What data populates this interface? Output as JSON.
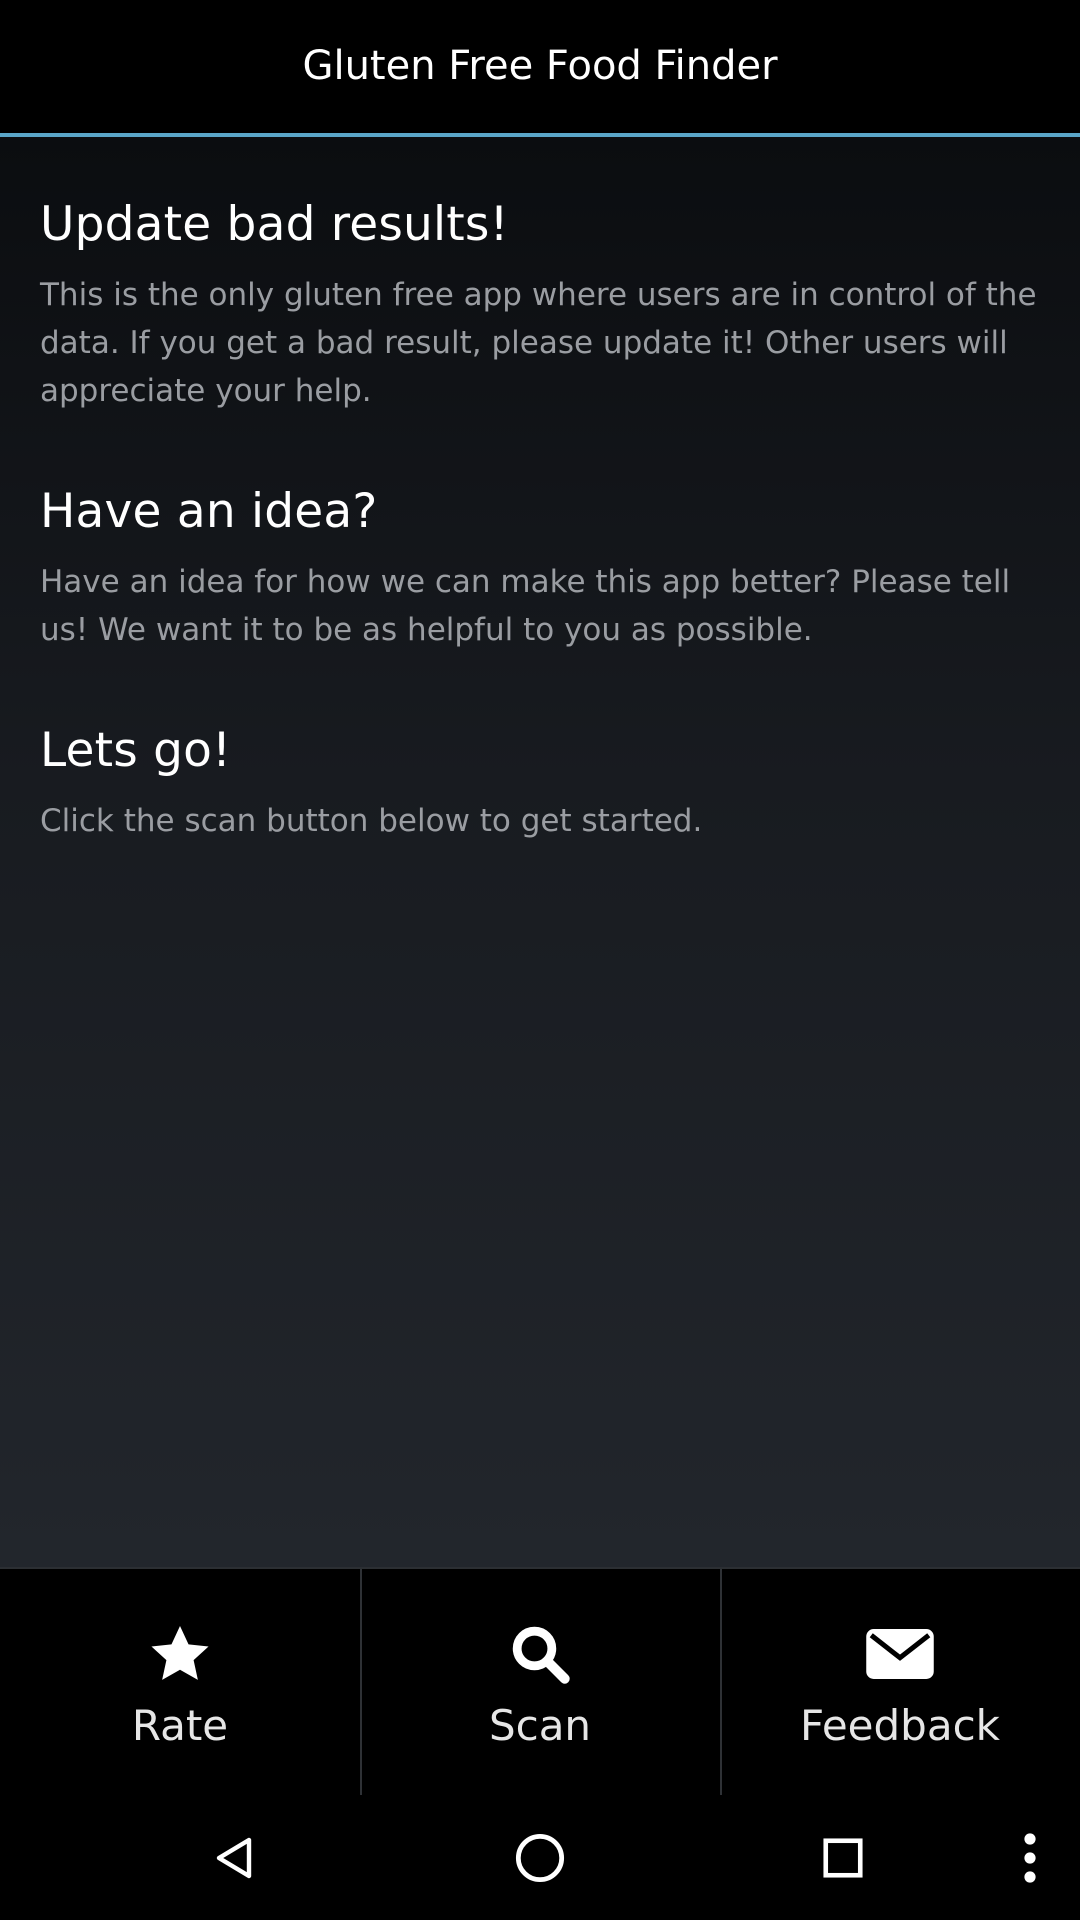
{
  "app": {
    "title": "Gluten Free Food Finder"
  },
  "sections": [
    {
      "heading": "Update bad results!",
      "body": "This is the only gluten free app where users are in control of the data. If you get a bad result, please update it! Other users will appreciate your help."
    },
    {
      "heading": "Have an idea?",
      "body": "Have an idea for how we can make this app better? Please tell us! We want it to be as helpful to you as possible."
    },
    {
      "heading": "Lets go!",
      "body": "Click the scan button below to get started."
    }
  ],
  "bottom_bar": {
    "tabs": [
      {
        "label": "Rate",
        "icon": "star-icon"
      },
      {
        "label": "Scan",
        "icon": "search-icon"
      },
      {
        "label": "Feedback",
        "icon": "envelope-icon"
      }
    ]
  },
  "nav_bar": {
    "buttons": [
      "back-icon",
      "home-icon",
      "recents-icon",
      "overflow-menu-icon"
    ]
  },
  "colors": {
    "accent": "#5aa5c8",
    "background": "#000000",
    "heading_text": "#ffffff",
    "body_text": "#9a9da2"
  }
}
